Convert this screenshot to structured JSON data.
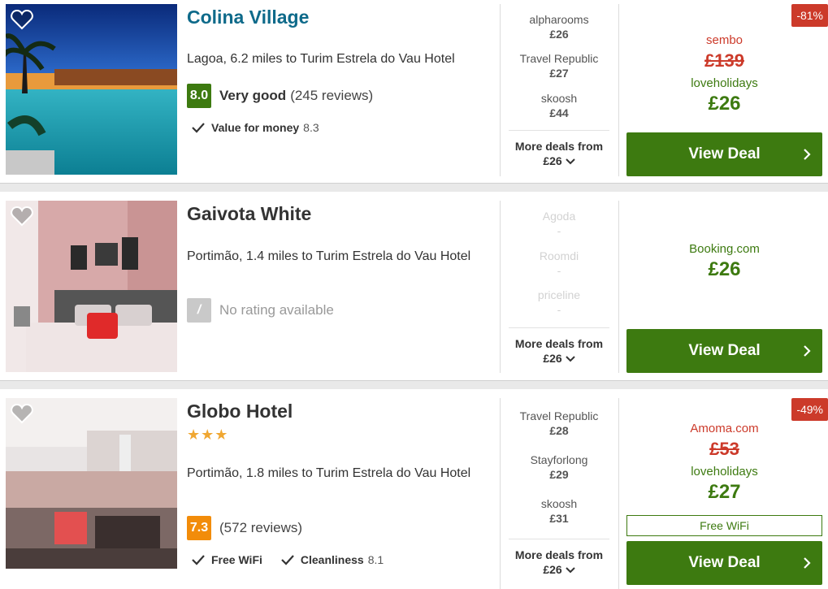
{
  "hotels": [
    {
      "name": "Colina Village",
      "location": "Lagoa, 6.2 miles to Turim Estrela do Vau Hotel",
      "score": "8.0",
      "rating_label": "Very good",
      "reviews": "(245 reviews)",
      "amenity": {
        "label": "Value for money",
        "value": "8.3"
      },
      "deals": [
        {
          "provider": "alpharooms",
          "price": "£26"
        },
        {
          "provider": "Travel Republic",
          "price": "£27"
        },
        {
          "provider": "skoosh",
          "price": "£44"
        }
      ],
      "more_deals": {
        "label": "More deals from",
        "price": "£26"
      },
      "discount": "-81%",
      "original_provider": "sembo",
      "original_price": "£139",
      "best_provider": "loveholidays",
      "best_price": "£26",
      "button": "View Deal"
    },
    {
      "name": "Gaivota White",
      "location": "Portimão, 1.4 miles to Turim Estrela do Vau Hotel",
      "score": "/",
      "no_rating": "No rating available",
      "deals": [
        {
          "provider": "Agoda",
          "price": "-"
        },
        {
          "provider": "Roomdi",
          "price": "-"
        },
        {
          "provider": "priceline",
          "price": "-"
        }
      ],
      "more_deals": {
        "label": "More deals from",
        "price": "£26"
      },
      "best_provider": "Booking.com",
      "best_price": "£26",
      "button": "View Deal"
    },
    {
      "name": "Globo Hotel",
      "stars": "★★★",
      "star_count": 3,
      "location": "Portimão, 1.8 miles to Turim Estrela do Vau Hotel",
      "score": "7.3",
      "reviews": "(572 reviews)",
      "amenities": [
        {
          "label": "Free WiFi",
          "value": ""
        },
        {
          "label": "Cleanliness",
          "value": "8.1"
        }
      ],
      "deals": [
        {
          "provider": "Travel Republic",
          "price": "£28"
        },
        {
          "provider": "Stayforlong",
          "price": "£29"
        },
        {
          "provider": "skoosh",
          "price": "£31"
        }
      ],
      "more_deals": {
        "label": "More deals from",
        "price": "£26"
      },
      "discount": "-49%",
      "original_provider": "Amoma.com",
      "original_price": "£53",
      "best_provider": "loveholidays",
      "best_price": "£27",
      "perk": "Free WiFi",
      "button": "View Deal"
    }
  ],
  "colors": {
    "accent_green": "#3d7a10",
    "discount_red": "#cc3a2a",
    "link_blue": "#0e6a8a",
    "score_orange": "#f28c0a"
  }
}
